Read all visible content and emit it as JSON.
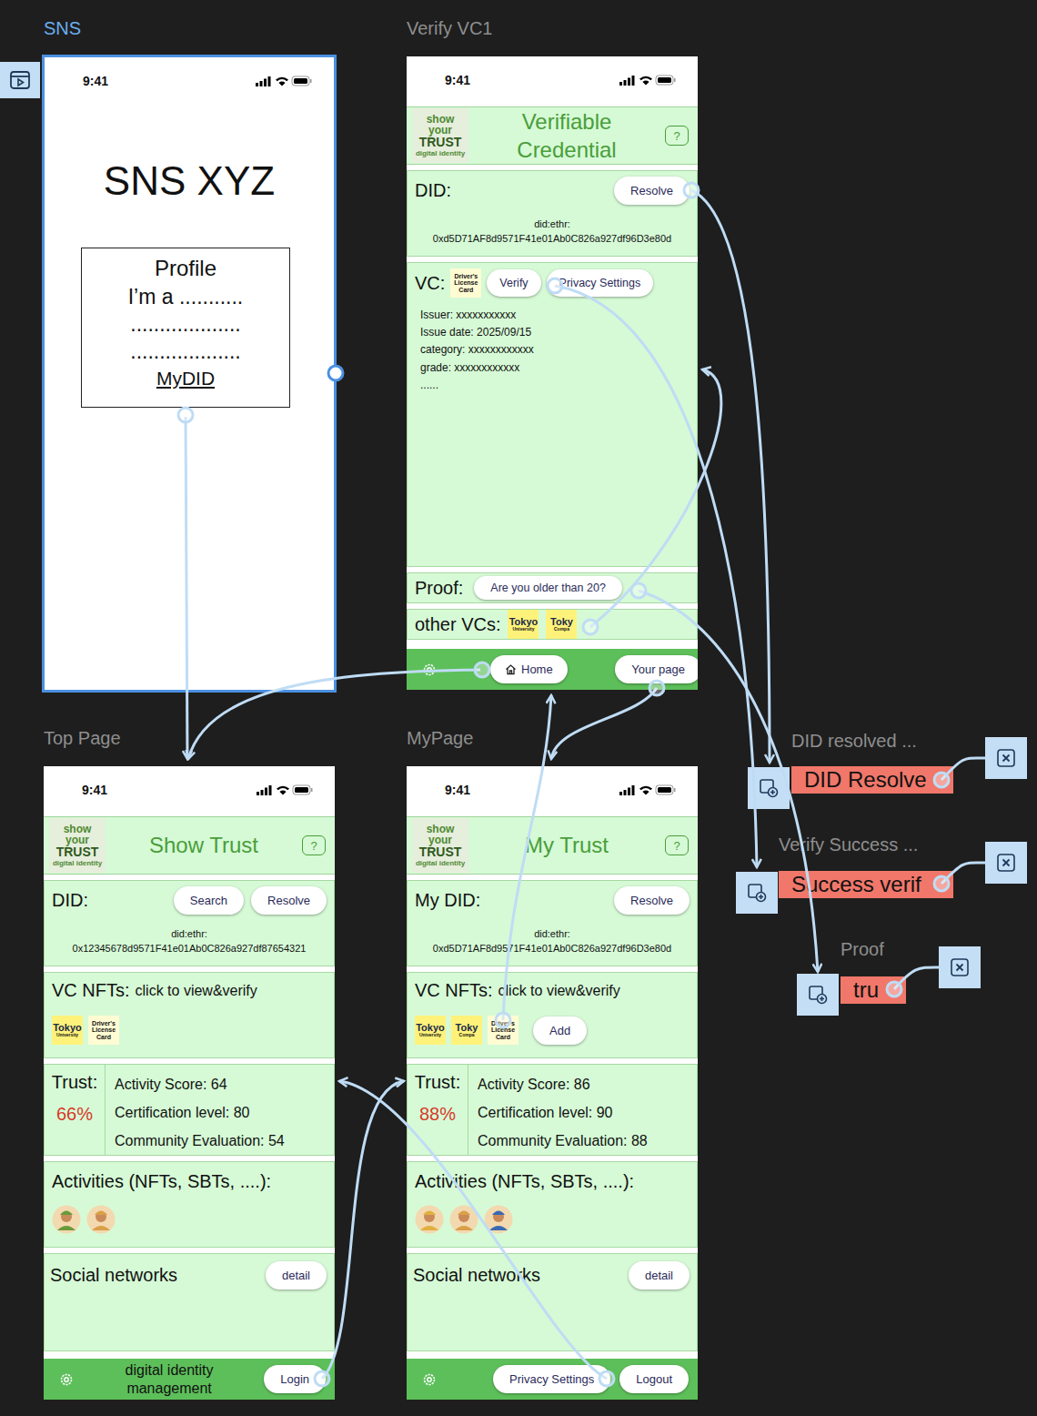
{
  "sns": {
    "label": "SNS",
    "selected": true,
    "time": "9:41",
    "title": "SNS XYZ",
    "profile": {
      "heading": "Profile",
      "lines": [
        "I’m a ...........",
        "...................",
        "..................."
      ],
      "link": "MyDID"
    }
  },
  "verify": {
    "label": "Verify VC1",
    "selected": false,
    "time": "9:41",
    "title": "Verifiable Credential",
    "help": "?",
    "did": {
      "label": "DID:",
      "buttons": [
        "Resolve"
      ],
      "method": "did:ethr:",
      "address": "0xd5D71AF8d9571F41e01Ab0C826a927df96D3e80d"
    },
    "vc": {
      "label": "VC:",
      "thumb": {
        "kind": "license",
        "lines": [
          "Driver's",
          "License",
          "Card"
        ]
      },
      "buttons": [
        "Verify",
        "Privacy Settings"
      ],
      "details": [
        "Issuer: xxxxxxxxxxx",
        "Issue date: 2025/09/15",
        "category: xxxxxxxxxxxx",
        "grade: xxxxxxxxxxxx",
        "......"
      ]
    },
    "proof": {
      "label": "Proof:",
      "button": "Are you older than 20?"
    },
    "other": {
      "label": "other VCs:",
      "thumbs": [
        {
          "kind": "tokyo",
          "lines": [
            "Tokyo",
            "University"
          ]
        },
        {
          "kind": "tokyo",
          "lines": [
            "Toky",
            "Compa"
          ]
        }
      ]
    },
    "footer": {
      "home": "Home",
      "your_page": "Your page"
    }
  },
  "logo": {
    "top": "show",
    "mid": "your",
    "main": "TRUST",
    "sub": "digital identity"
  },
  "top_page": {
    "label": "Top Page",
    "selected": false,
    "time": "9:41",
    "title": "Show Trust",
    "help": "?",
    "did": {
      "label": "DID:",
      "buttons": [
        "Search",
        "Resolve"
      ],
      "method": "did:ethr:",
      "address": "0x12345678d9571F41e01Ab0C826a927df87654321"
    },
    "nfts": {
      "label": "VC NFTs:",
      "hint": "click to view&verify",
      "thumbs": [
        {
          "kind": "tokyo",
          "lines": [
            "Tokyo",
            "University"
          ]
        },
        {
          "kind": "license",
          "lines": [
            "Driver's",
            "License",
            "Card"
          ]
        }
      ],
      "add": ""
    },
    "trust": {
      "label": "Trust:",
      "percent": "66%",
      "metrics": [
        "Activity Score: 64",
        "Certification level:  80",
        "Community Evaluation: 54"
      ]
    },
    "activities": {
      "label": "Activities (NFTs, SBTs, ....):",
      "avatars": [
        {
          "color": "#6a9a3a"
        },
        {
          "color": "#d9a04a"
        }
      ]
    },
    "social": {
      "label": "Social networks",
      "button": "detail"
    },
    "footer": {
      "caption": "digital identity management",
      "buttons": [
        "Login"
      ]
    }
  },
  "my_page": {
    "label": "MyPage",
    "selected": false,
    "time": "9:41",
    "title": "My Trust",
    "help": "?",
    "did": {
      "label": "My DID:",
      "buttons": [
        "Resolve"
      ],
      "method": "did:ethr:",
      "address": "0xd5D71AF8d9571F41e01Ab0C826a927df96D3e80d"
    },
    "nfts": {
      "label": "VC NFTs:",
      "hint": "click to view&verify",
      "thumbs": [
        {
          "kind": "tokyo",
          "lines": [
            "Tokyo",
            "University"
          ]
        },
        {
          "kind": "tokyo",
          "lines": [
            "Toky",
            "Compa"
          ]
        },
        {
          "kind": "license",
          "lines": [
            "Driver's",
            "License",
            "Card"
          ]
        }
      ],
      "add": "Add"
    },
    "trust": {
      "label": "Trust:",
      "percent": "88%",
      "metrics": [
        "Activity Score: 86",
        "Certification level:  90",
        "Community Evaluation: 88"
      ]
    },
    "activities": {
      "label": "Activities (NFTs, SBTs, ....):",
      "avatars": [
        {
          "color": "#e0b040"
        },
        {
          "color": "#d9a04a"
        },
        {
          "color": "#3a6ab0"
        }
      ]
    },
    "social": {
      "label": "Social networks",
      "button": "detail"
    },
    "footer": {
      "caption": "",
      "buttons": [
        "Privacy Settings",
        "Logout"
      ]
    }
  },
  "overlays": [
    {
      "label": "DID resolved ...",
      "text": "DID Resolve"
    },
    {
      "label": "Verify Success ...",
      "text": "Success verif"
    },
    {
      "label": "Proof",
      "text": "tru"
    }
  ]
}
